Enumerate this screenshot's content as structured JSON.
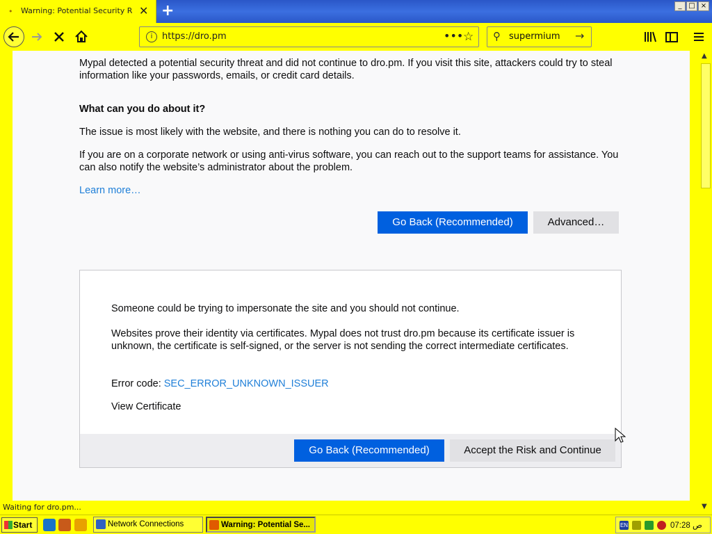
{
  "browser": {
    "tab_title": "Warning: Potential Security Risk A",
    "new_tab_label": "+",
    "url": "https://dro.pm",
    "search_query": "supermium",
    "window_controls": [
      "_",
      "□",
      "×"
    ]
  },
  "page": {
    "intro": "Mypal detected a potential security threat and did not continue to dro.pm. If you visit this site, attackers could try to steal information like your passwords, emails, or credit card details.",
    "heading": "What can you do about it?",
    "para1": "The issue is most likely with the website, and there is nothing you can do to resolve it.",
    "para2": "If you are on a corporate network or using anti-virus software, you can reach out to the support teams for assistance. You can also notify the website’s administrator about the problem.",
    "learn_more": "Learn more…",
    "go_back_label": "Go Back (Recommended)",
    "advanced_label": "Advanced…"
  },
  "advanced": {
    "text1": "Someone could be trying to impersonate the site and you should not continue.",
    "text2": "Websites prove their identity via certificates. Mypal does not trust dro.pm because its certificate issuer is unknown, the certificate is self-signed, or the server is not sending the correct intermediate certificates.",
    "error_label": "Error code: ",
    "error_code": "SEC_ERROR_UNKNOWN_ISSUER",
    "view_certificate": "View Certificate",
    "go_back_label": "Go Back (Recommended)",
    "accept_label": "Accept the Risk and Continue"
  },
  "status": "Waiting for dro.pm...",
  "taskbar": {
    "start_label": "Start",
    "network_task": "Network Connections",
    "browser_task": "Warning: Potential Se...",
    "lang": "EN",
    "clock": "07:28 ص"
  },
  "colors": {
    "chrome": "#ffff00",
    "primary_button": "#0060df",
    "link": "#1f7fd8"
  }
}
